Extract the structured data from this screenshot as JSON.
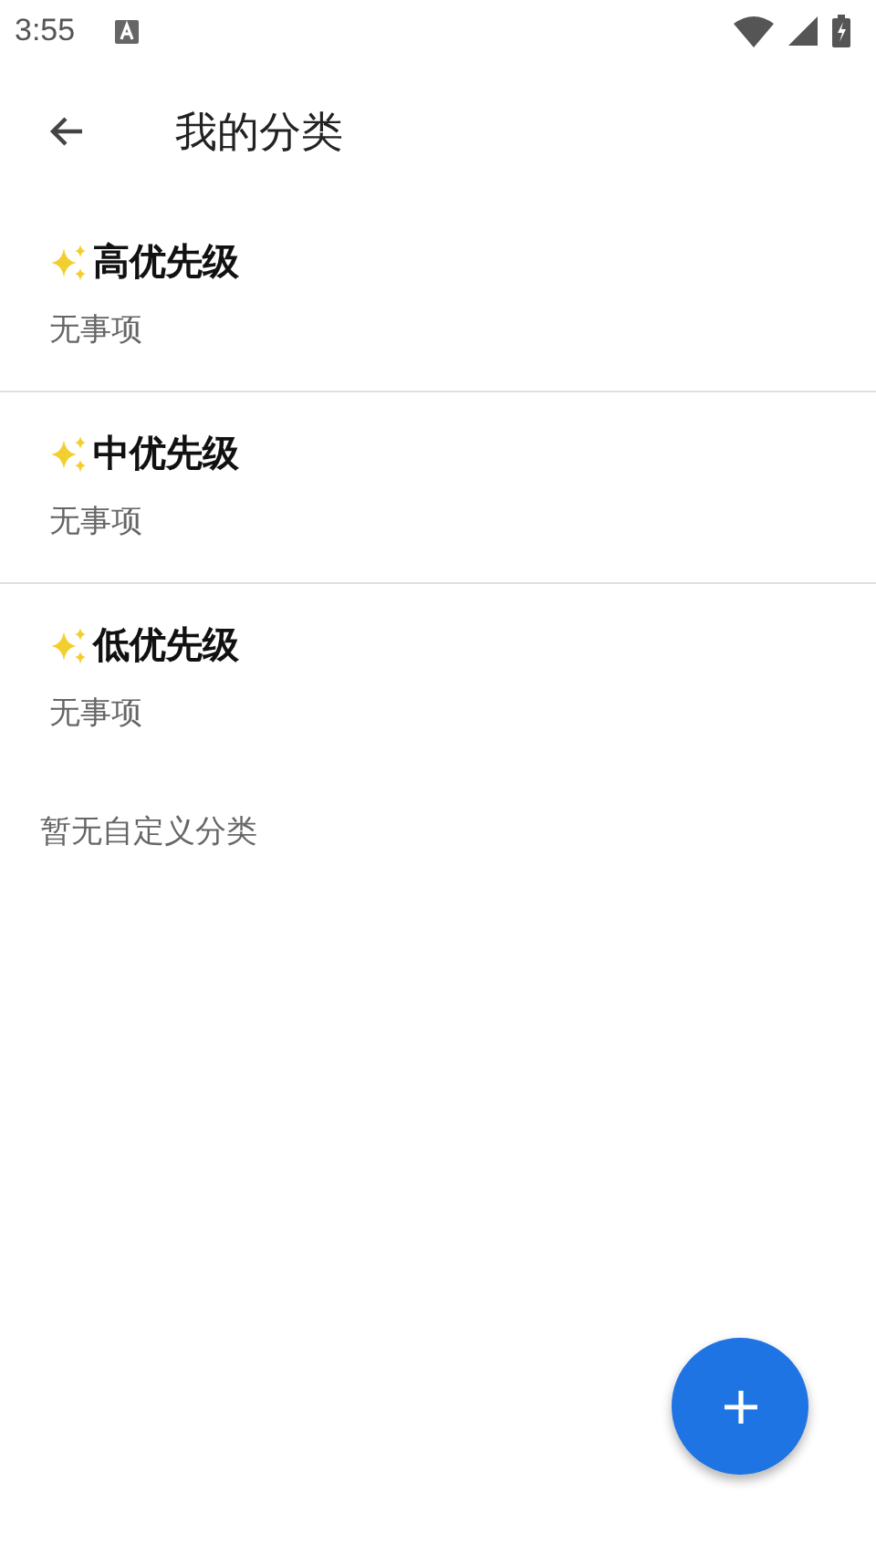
{
  "status_bar": {
    "time": "3:55"
  },
  "app_bar": {
    "title": "我的分类"
  },
  "categories": [
    {
      "name": "高优先级",
      "subtitle": "无事项"
    },
    {
      "name": "中优先级",
      "subtitle": "无事项"
    },
    {
      "name": "低优先级",
      "subtitle": "无事项"
    }
  ],
  "empty_message": "暂无自定义分类"
}
